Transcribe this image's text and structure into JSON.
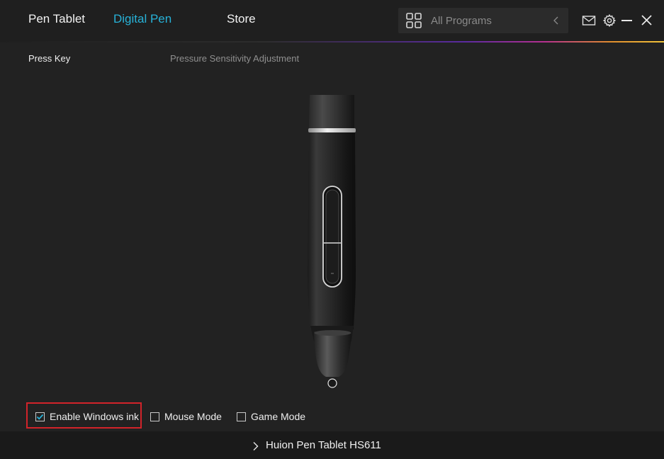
{
  "nav": {
    "tabs": [
      {
        "label": "Pen Tablet",
        "active": false
      },
      {
        "label": "Digital Pen",
        "active": true
      },
      {
        "label": "Store",
        "active": false
      }
    ]
  },
  "program_selector": {
    "label": "All Programs",
    "icon": "grid-icon"
  },
  "window_controls": {
    "icons": [
      "mail-icon",
      "gear-icon",
      "minimize-icon",
      "close-icon"
    ]
  },
  "subtabs": [
    {
      "label": "Press Key",
      "active": true
    },
    {
      "label": "Pressure Sensitivity Adjustment",
      "active": false
    }
  ],
  "options": [
    {
      "label": "Enable Windows ink",
      "checked": true,
      "highlighted": true
    },
    {
      "label": "Mouse Mode",
      "checked": false
    },
    {
      "label": "Game Mode",
      "checked": false
    }
  ],
  "footer": {
    "device_label": "Huion Pen Tablet HS611"
  },
  "colors": {
    "background": "#222222",
    "accent": "#27b2d8",
    "highlight": "#d2232a"
  }
}
